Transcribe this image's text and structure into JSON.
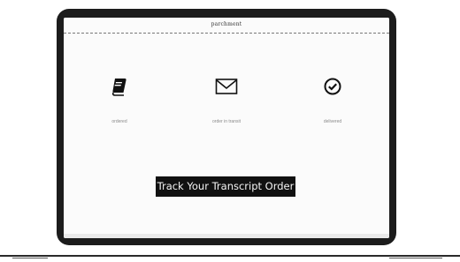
{
  "brand": {
    "logo_text": "parchment"
  },
  "steps": [
    {
      "icon": "book-icon",
      "label": "ordered"
    },
    {
      "icon": "envelope-icon",
      "label": "order in transit"
    },
    {
      "icon": "check-circle-icon",
      "label": "delivered"
    }
  ],
  "cta": {
    "label": "Track Your Transcript Order"
  },
  "colors": {
    "frame": "#1c1c1c",
    "screen": "#fbfbfb",
    "button_bg": "#111111",
    "button_text": "#f5f5f5"
  }
}
